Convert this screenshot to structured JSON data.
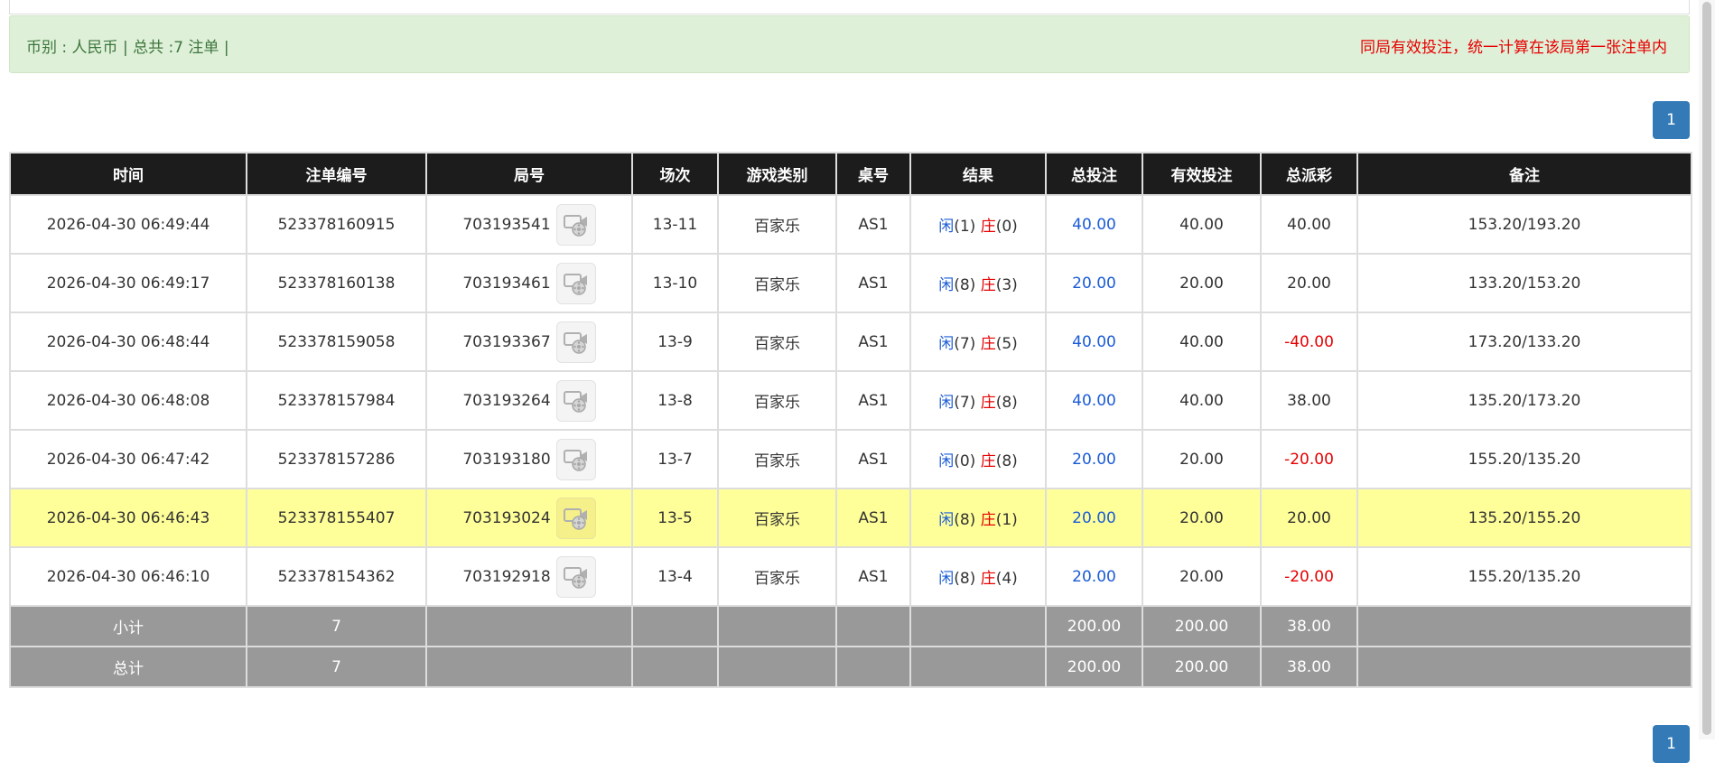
{
  "info_bar": {
    "left_text": "币别 : 人民币 | 总共 :7 注单 |",
    "right_text": "同局有效投注，统一计算在该局第一张注单内"
  },
  "pager": {
    "current_page": "1"
  },
  "table": {
    "columns": [
      "时间",
      "注单编号",
      "局号",
      "场次",
      "游戏类别",
      "桌号",
      "结果",
      "总投注",
      "有效投注",
      "总派彩",
      "备注"
    ],
    "rows": [
      {
        "time": "2026-04-30 06:49:44",
        "bet_id": "523378160915",
        "round_id": "703193541",
        "session": "13-11",
        "game": "百家乐",
        "table": "AS1",
        "player_label": "闲",
        "player_score": "(1)",
        "banker_label": "庄",
        "banker_score": "(0)",
        "total_bet": "40.00",
        "valid_bet": "40.00",
        "payout": "40.00",
        "payout_negative": false,
        "note": "153.20/193.20",
        "highlight": false
      },
      {
        "time": "2026-04-30 06:49:17",
        "bet_id": "523378160138",
        "round_id": "703193461",
        "session": "13-10",
        "game": "百家乐",
        "table": "AS1",
        "player_label": "闲",
        "player_score": "(8)",
        "banker_label": "庄",
        "banker_score": "(3)",
        "total_bet": "20.00",
        "valid_bet": "20.00",
        "payout": "20.00",
        "payout_negative": false,
        "note": "133.20/153.20",
        "highlight": false
      },
      {
        "time": "2026-04-30 06:48:44",
        "bet_id": "523378159058",
        "round_id": "703193367",
        "session": "13-9",
        "game": "百家乐",
        "table": "AS1",
        "player_label": "闲",
        "player_score": "(7)",
        "banker_label": "庄",
        "banker_score": "(5)",
        "total_bet": "40.00",
        "valid_bet": "40.00",
        "payout": "-40.00",
        "payout_negative": true,
        "note": "173.20/133.20",
        "highlight": false
      },
      {
        "time": "2026-04-30 06:48:08",
        "bet_id": "523378157984",
        "round_id": "703193264",
        "session": "13-8",
        "game": "百家乐",
        "table": "AS1",
        "player_label": "闲",
        "player_score": "(7)",
        "banker_label": "庄",
        "banker_score": "(8)",
        "total_bet": "40.00",
        "valid_bet": "40.00",
        "payout": "38.00",
        "payout_negative": false,
        "note": "135.20/173.20",
        "highlight": false
      },
      {
        "time": "2026-04-30 06:47:42",
        "bet_id": "523378157286",
        "round_id": "703193180",
        "session": "13-7",
        "game": "百家乐",
        "table": "AS1",
        "player_label": "闲",
        "player_score": "(0)",
        "banker_label": "庄",
        "banker_score": "(8)",
        "total_bet": "20.00",
        "valid_bet": "20.00",
        "payout": "-20.00",
        "payout_negative": true,
        "note": "155.20/135.20",
        "highlight": false
      },
      {
        "time": "2026-04-30 06:46:43",
        "bet_id": "523378155407",
        "round_id": "703193024",
        "session": "13-5",
        "game": "百家乐",
        "table": "AS1",
        "player_label": "闲",
        "player_score": "(8)",
        "banker_label": "庄",
        "banker_score": "(1)",
        "total_bet": "20.00",
        "valid_bet": "20.00",
        "payout": "20.00",
        "payout_negative": false,
        "note": "135.20/155.20",
        "highlight": true
      },
      {
        "time": "2026-04-30 06:46:10",
        "bet_id": "523378154362",
        "round_id": "703192918",
        "session": "13-4",
        "game": "百家乐",
        "table": "AS1",
        "player_label": "闲",
        "player_score": "(8)",
        "banker_label": "庄",
        "banker_score": "(4)",
        "total_bet": "20.00",
        "valid_bet": "20.00",
        "payout": "-20.00",
        "payout_negative": true,
        "note": "155.20/135.20",
        "highlight": false
      }
    ],
    "subtotal": {
      "label": "小计",
      "count": "7",
      "total_bet": "200.00",
      "valid_bet": "200.00",
      "payout": "38.00"
    },
    "grand_total": {
      "label": "总计",
      "count": "7",
      "total_bet": "200.00",
      "valid_bet": "200.00",
      "payout": "38.00"
    }
  },
  "icons": {
    "round_replay": "film-reel-icon"
  },
  "colors": {
    "header_bg": "#1c1c1c",
    "summary_bg": "#999999",
    "highlight_row": "#ffff99",
    "info_bg": "#dff0d8",
    "pager_bg": "#337ab7",
    "blue_text": "#1a5bd6",
    "red_text": "#e60000"
  }
}
